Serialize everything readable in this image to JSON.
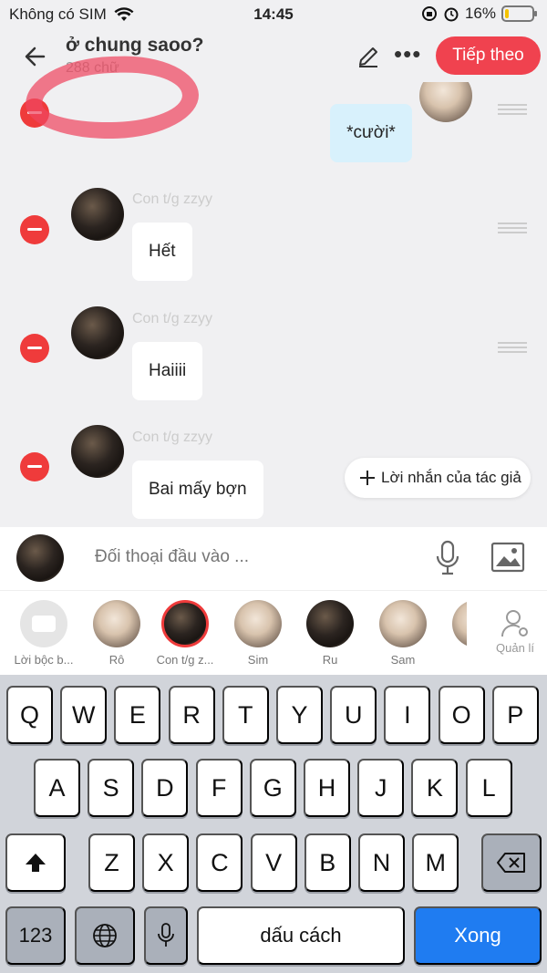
{
  "status_bar": {
    "carrier": "Không có SIM",
    "time": "14:45",
    "battery": "16%",
    "battery_level": 0.16
  },
  "header": {
    "title": "ở chung saoo?",
    "word_count": "288 chữ",
    "next_label": "Tiếp theo"
  },
  "messages": [
    {
      "sender": "Con t/g zzyy",
      "text": "Hết"
    },
    {
      "sender": "Con t/g zzyy",
      "text": "Haiiii"
    },
    {
      "sender": "Con t/g zzyy",
      "text": "Bai mấy bợn"
    }
  ],
  "top_message": {
    "text": "*cười*"
  },
  "author_note_button": "Lời nhắn của tác giả",
  "input": {
    "placeholder": "Đối thoại đầu vào ..."
  },
  "characters": [
    {
      "label": "Lời bộc b..."
    },
    {
      "label": "Rô"
    },
    {
      "label": "Con t/g z..."
    },
    {
      "label": "Sim"
    },
    {
      "label": "Ru"
    },
    {
      "label": "Sam"
    }
  ],
  "manage_label": "Quản lí",
  "keyboard": {
    "row1": [
      "Q",
      "W",
      "E",
      "R",
      "T",
      "Y",
      "U",
      "I",
      "O",
      "P"
    ],
    "row2": [
      "A",
      "S",
      "D",
      "F",
      "G",
      "H",
      "J",
      "K",
      "L"
    ],
    "row3": [
      "Z",
      "X",
      "C",
      "V",
      "B",
      "N",
      "M"
    ],
    "num_label": "123",
    "space_label": "dấu cách",
    "done_label": "Xong"
  },
  "colors": {
    "accent": "#f0424f",
    "delete": "#ef3b3b",
    "done": "#1f7cf1",
    "bubble_blue": "#d8f1fc"
  }
}
